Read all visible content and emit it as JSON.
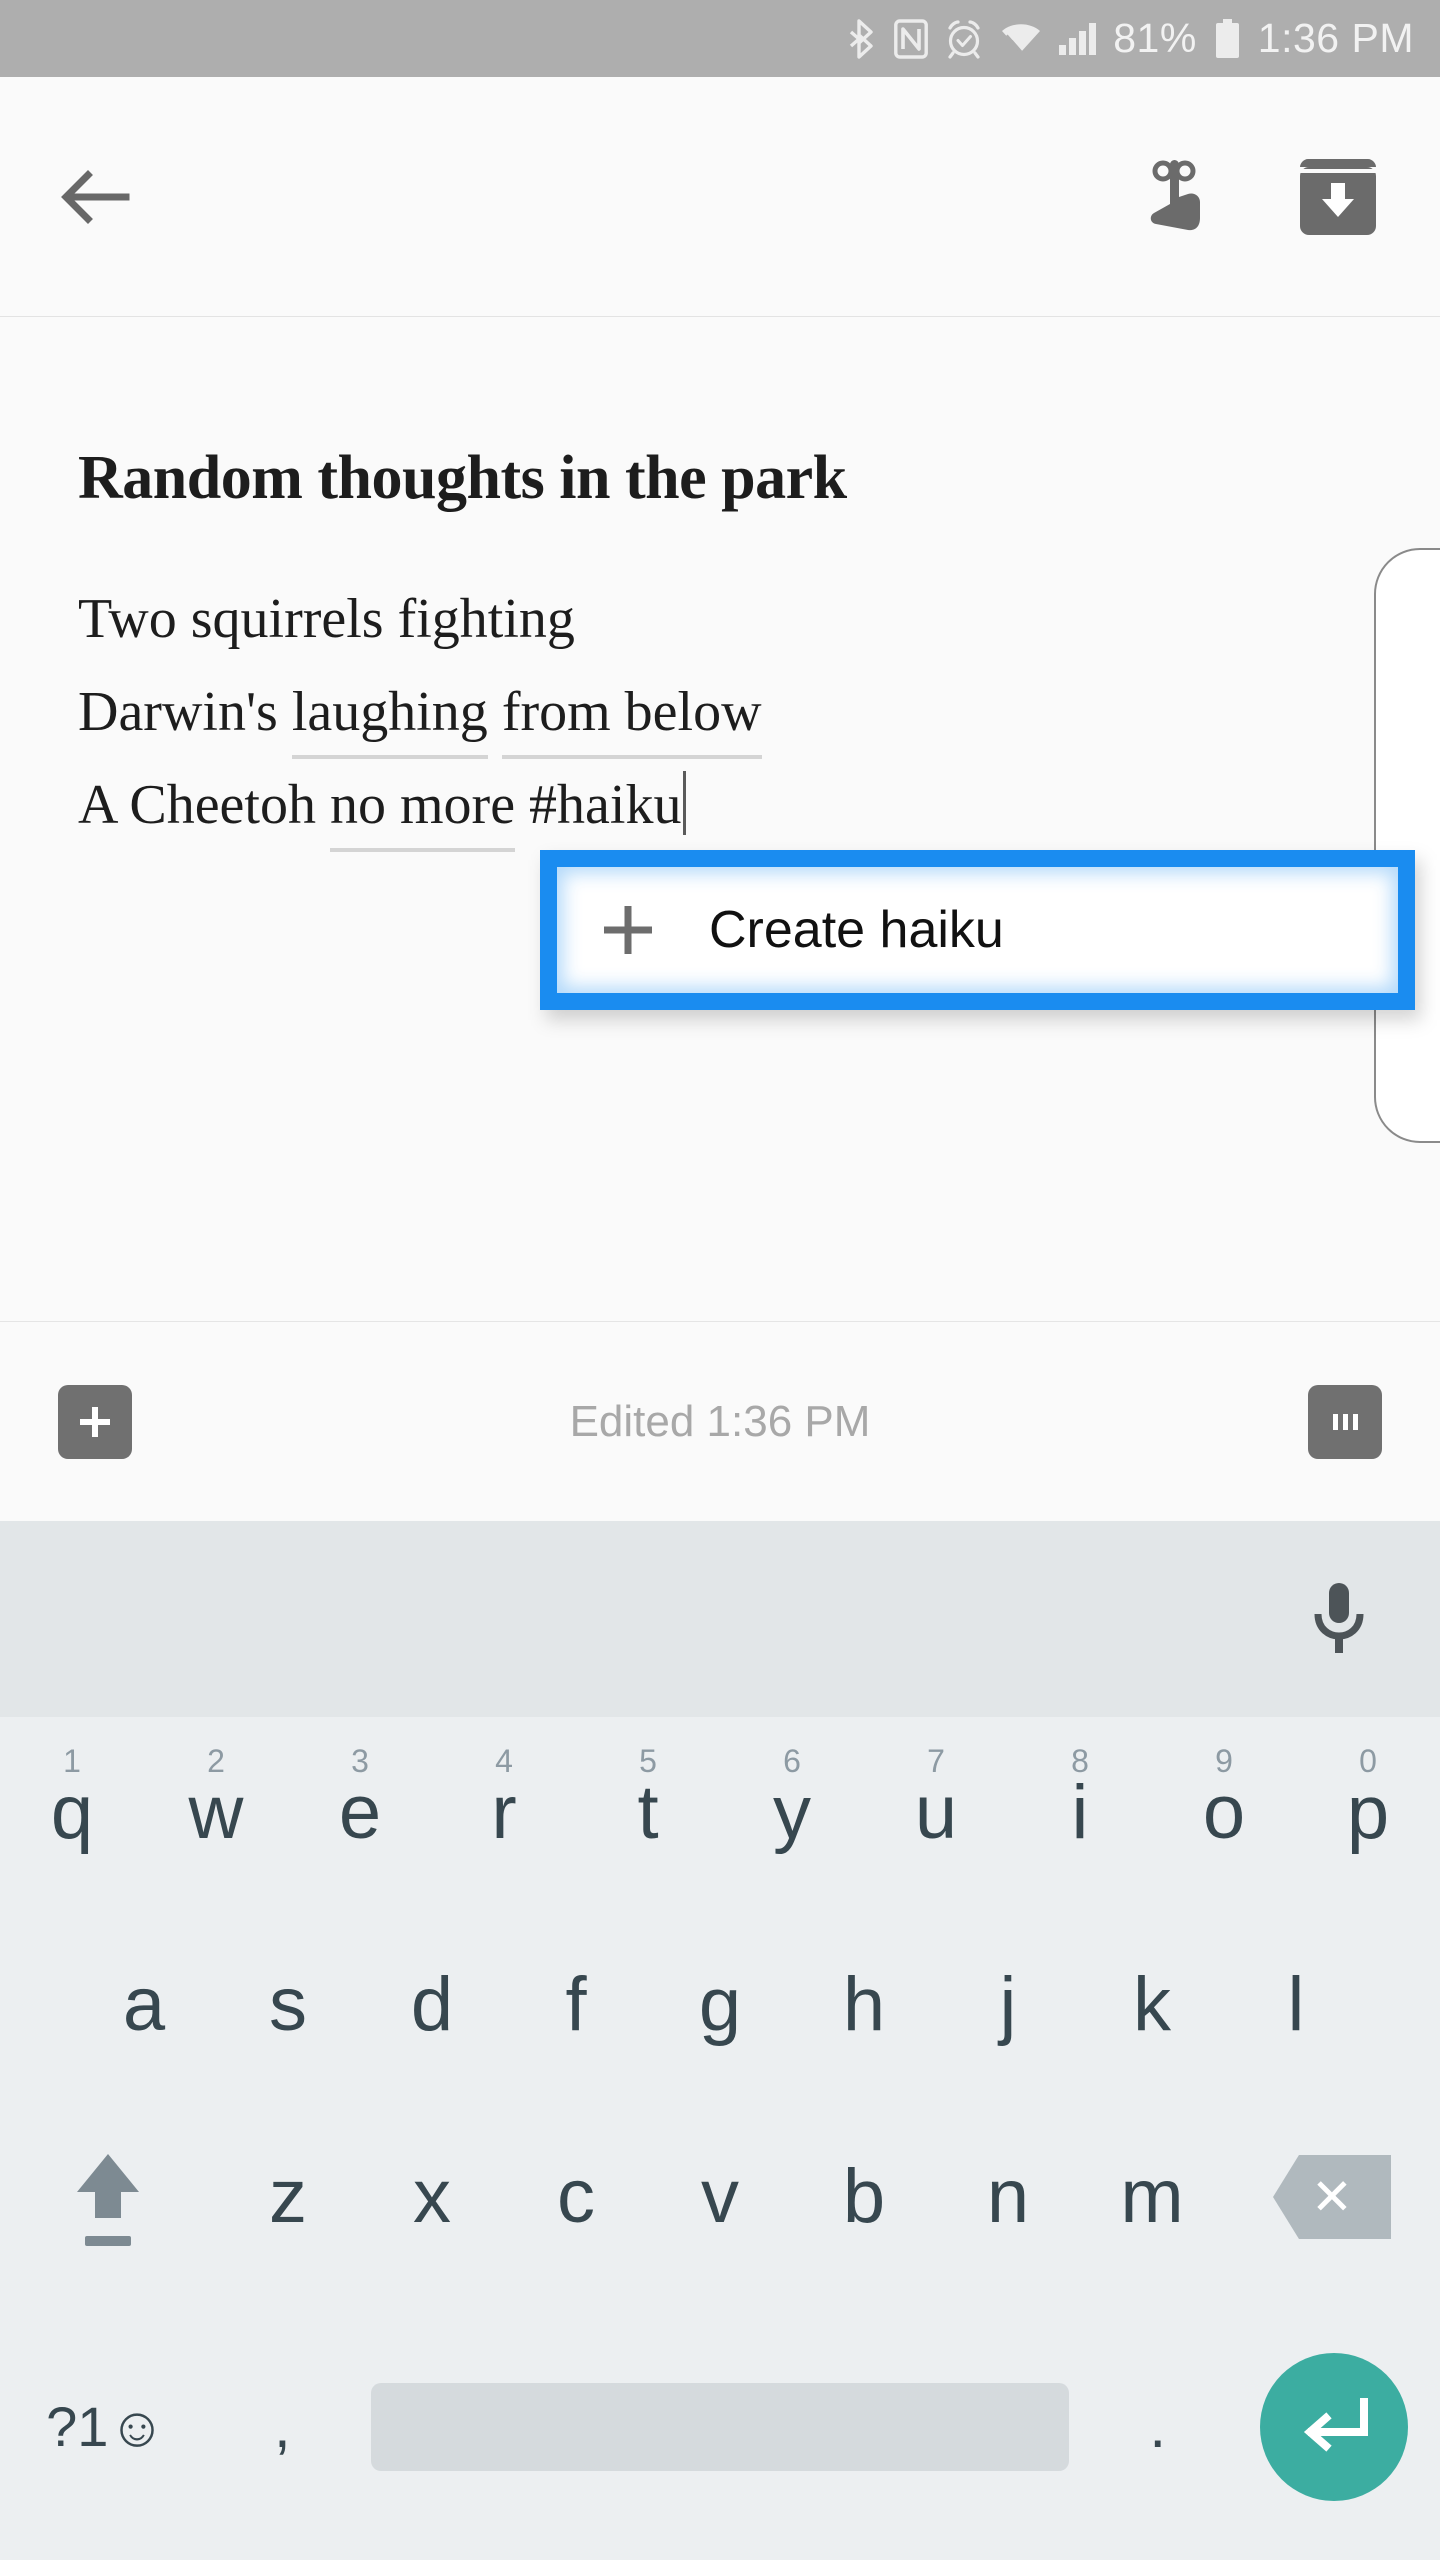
{
  "status_bar": {
    "battery_percent": "81%",
    "time": "1:36 PM",
    "icons": [
      "bluetooth-icon",
      "nfc-icon",
      "alarm-icon",
      "wifi-icon",
      "signal-icon",
      "battery-icon"
    ],
    "background_color": "#aeaeae",
    "text_color": "#f2f2f2"
  },
  "app_bar": {
    "back_label": "back-arrow",
    "reminder_label": "reminder-finger-string",
    "archive_label": "archive-box-down-arrow"
  },
  "note": {
    "title": "Random thoughts in the park",
    "lines": [
      {
        "segments": [
          {
            "text": "Two squirrels fighting",
            "underlined": false
          }
        ]
      },
      {
        "segments": [
          {
            "text": "Darwin's ",
            "underlined": false
          },
          {
            "text": "laughing",
            "underlined": true
          },
          {
            "text": " ",
            "underlined": false
          },
          {
            "text": "from below",
            "underlined": true
          }
        ]
      },
      {
        "segments": [
          {
            "text": "A Cheetoh ",
            "underlined": false
          },
          {
            "text": "no more",
            "underlined": true
          },
          {
            "text": " #haiku",
            "underlined": false
          }
        ],
        "caret": true
      }
    ]
  },
  "haiku_popup": {
    "label": "Create haiku",
    "plus_icon": "plus-icon",
    "highlight_color": "#1a8cf0",
    "inner_background": "#ffffff"
  },
  "footer": {
    "add_label": "add-attachment",
    "edited_text": "Edited 1:36 PM",
    "overflow_label": "more-options",
    "button_color": "#707070",
    "text_color": "#a8a8a8"
  },
  "keyboard": {
    "background": "#eceff1",
    "strip_background": "#e2e6e8",
    "mic_icon": "microphone-icon",
    "row1": [
      {
        "letter": "q",
        "number": "1"
      },
      {
        "letter": "w",
        "number": "2"
      },
      {
        "letter": "e",
        "number": "3"
      },
      {
        "letter": "r",
        "number": "4"
      },
      {
        "letter": "t",
        "number": "5"
      },
      {
        "letter": "y",
        "number": "6"
      },
      {
        "letter": "u",
        "number": "7"
      },
      {
        "letter": "i",
        "number": "8"
      },
      {
        "letter": "o",
        "number": "9"
      },
      {
        "letter": "p",
        "number": "0"
      }
    ],
    "row2": [
      "a",
      "s",
      "d",
      "f",
      "g",
      "h",
      "j",
      "k",
      "l"
    ],
    "row3": [
      "z",
      "x",
      "c",
      "v",
      "b",
      "n",
      "m"
    ],
    "shift_label": "shift-key",
    "backspace_label": "backspace-key",
    "backspace_glyph": "✕",
    "symbols_label": "?1☺",
    "comma_label": ",",
    "period_label": ".",
    "space_label": "space-bar",
    "enter_label": "enter-key",
    "enter_color": "#3cada1"
  }
}
